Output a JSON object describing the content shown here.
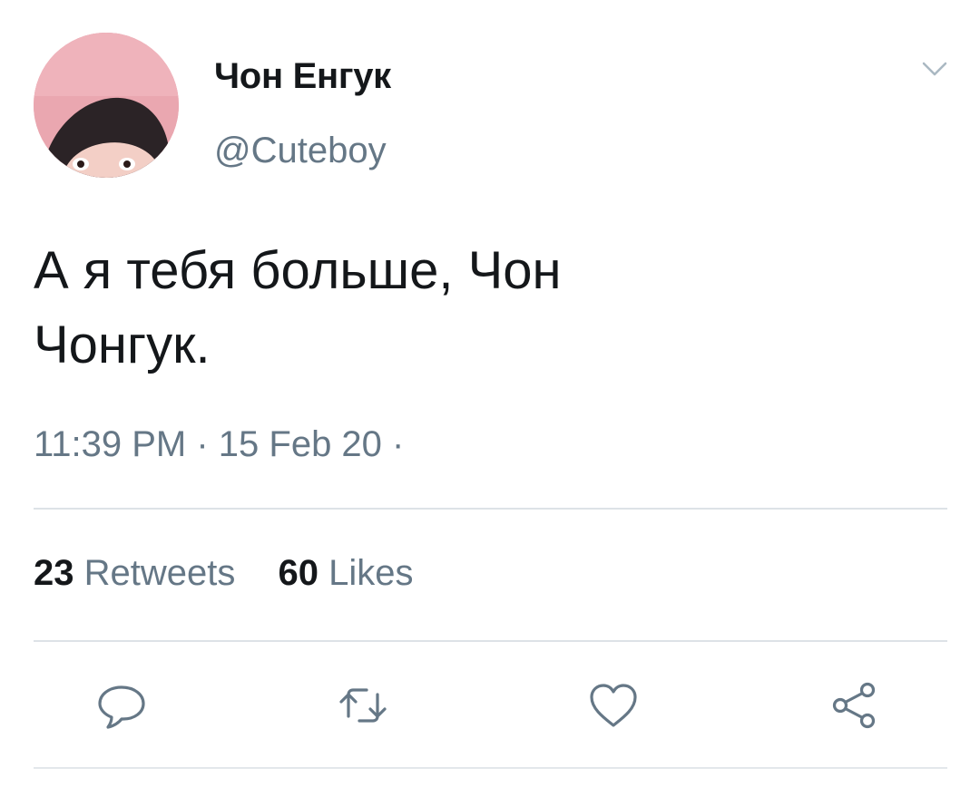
{
  "user": {
    "display_name": "Чон Енгук",
    "handle": "@Cuteboy",
    "avatar_icon": "user-avatar-photo"
  },
  "tweet": {
    "text_line1": "А я тебя больше, Чон",
    "text_line2": "Чонгук.",
    "timestamp": "11:39 PM · 15 Feb 20 ·"
  },
  "stats": {
    "retweets_count": "23",
    "retweets_label": "Retweets",
    "likes_count": "60",
    "likes_label": "Likes"
  },
  "actions": {
    "reply_icon": "reply-icon",
    "retweet_icon": "retweet-icon",
    "like_icon": "heart-icon",
    "share_icon": "share-icon"
  },
  "colors": {
    "text_primary": "#14171a",
    "text_secondary": "#657786",
    "divider": "#dde2e7",
    "icon": "#657786"
  }
}
